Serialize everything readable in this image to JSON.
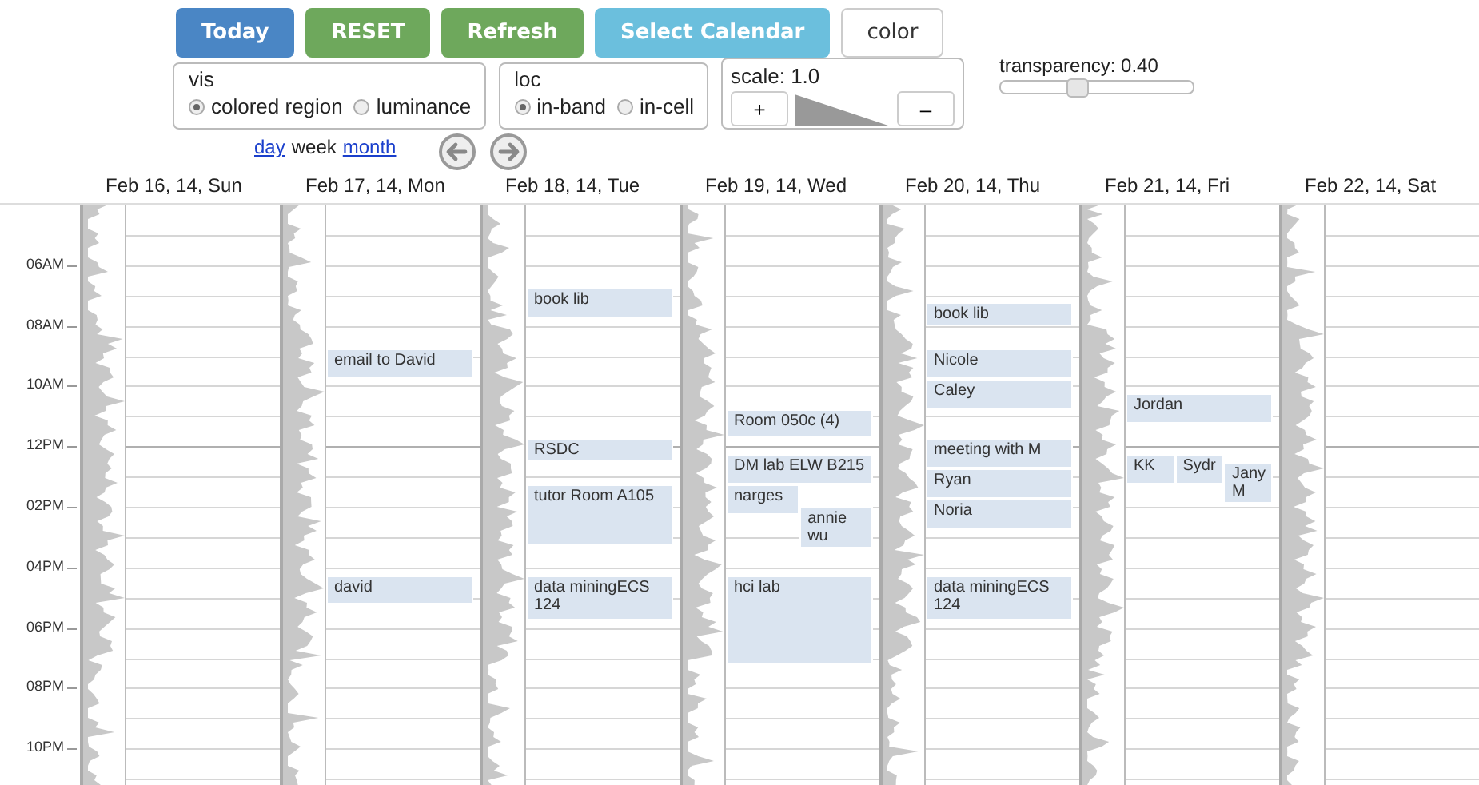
{
  "toolbar": {
    "buttons": [
      {
        "label": "Today",
        "kind": "primary"
      },
      {
        "label": "RESET",
        "kind": "success"
      },
      {
        "label": "Refresh",
        "kind": "success"
      },
      {
        "label": "Select Calendar",
        "kind": "info"
      },
      {
        "label": "color",
        "kind": "plain"
      }
    ]
  },
  "options": [
    {
      "title": "vis",
      "choices": [
        {
          "label": "colored region",
          "selected": true
        },
        {
          "label": "luminance",
          "selected": false
        }
      ]
    },
    {
      "title": "loc",
      "choices": [
        {
          "label": "in-band",
          "selected": true
        },
        {
          "label": "in-cell",
          "selected": false
        }
      ]
    }
  ],
  "scale": {
    "label": "scale: 1.0",
    "plus": "+",
    "minus": "–"
  },
  "transparency": {
    "label": "transparency: 0.40",
    "level": 0.4
  },
  "views": [
    {
      "label": "day",
      "selected": false
    },
    {
      "label": "week",
      "selected": true
    },
    {
      "label": "month",
      "selected": false
    }
  ],
  "time_labels": [
    "06AM",
    "08AM",
    "10AM",
    "12PM",
    "02PM",
    "04PM",
    "06PM",
    "08PM",
    "10PM"
  ],
  "days": [
    {
      "label": "Feb 16, 14, Sun"
    },
    {
      "label": "Feb 17, 14, Mon",
      "events": [
        {
          "title": "email to David"
        },
        {
          "title": "david"
        }
      ]
    },
    {
      "label": "Feb 18, 14, Tue",
      "events": [
        {
          "title": "book lib"
        },
        {
          "title": "RSDC"
        },
        {
          "title": "tutor Room A105"
        },
        {
          "title": "data miningECS 124"
        }
      ]
    },
    {
      "label": "Feb 19, 14, Wed",
      "events": [
        {
          "title": "Room 050c (4)"
        },
        {
          "title": "DM lab ELW B215"
        },
        {
          "title": "narges"
        },
        {
          "title": "annie wu"
        },
        {
          "title": "hci lab"
        }
      ]
    },
    {
      "label": "Feb 20, 14, Thu",
      "events": [
        {
          "title": "book lib"
        },
        {
          "title": "Nicole"
        },
        {
          "title": "Caley"
        },
        {
          "title": "meeting with M"
        },
        {
          "title": "Ryan"
        },
        {
          "title": "Noria"
        },
        {
          "title": "data miningECS 124"
        }
      ]
    },
    {
      "label": "Feb 21, 14, Fri",
      "events": [
        {
          "title": "Jordan"
        },
        {
          "title": "KK"
        },
        {
          "title": "Sydr"
        },
        {
          "title": "Jany M"
        }
      ]
    },
    {
      "label": "Feb 22, 14, Sat"
    }
  ]
}
